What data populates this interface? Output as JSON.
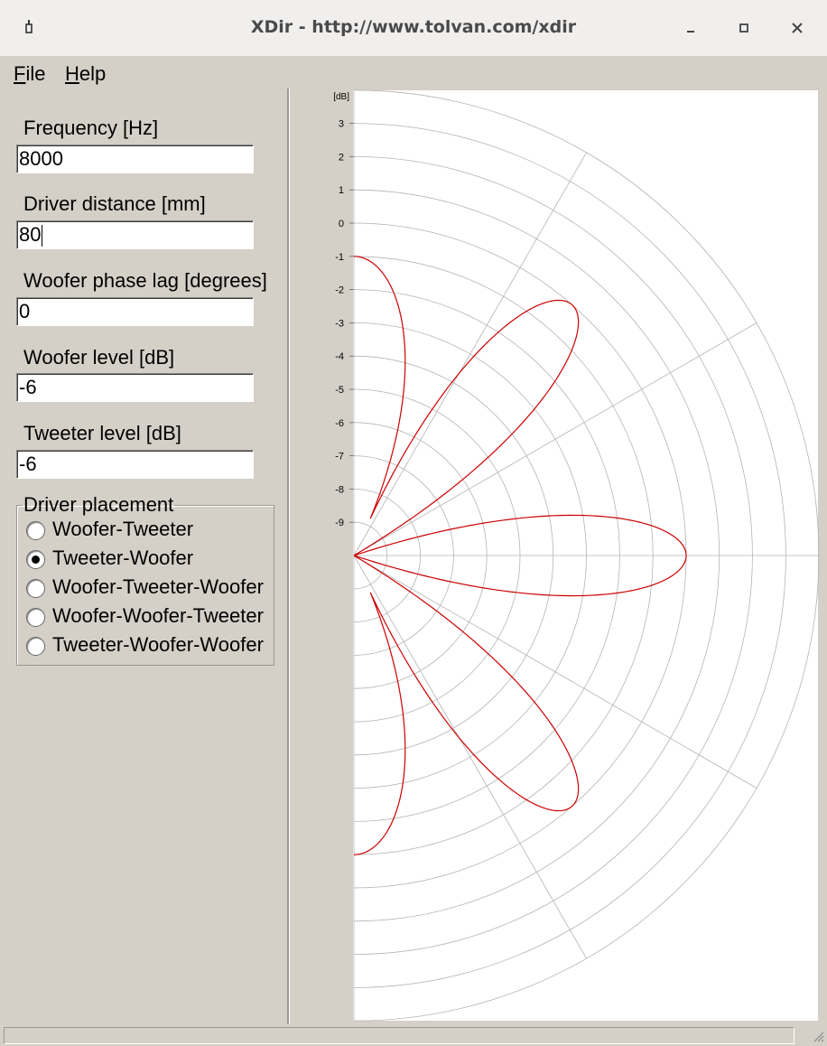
{
  "window": {
    "title": "XDir - http://www.tolvan.com/xdir",
    "icons": {
      "system": "pin-icon",
      "minimize": "minimize-icon",
      "maximize": "maximize-icon",
      "close": "close-icon"
    }
  },
  "menu": {
    "file": {
      "accel": "F",
      "rest": "ile"
    },
    "help": {
      "accel": "H",
      "rest": "elp"
    }
  },
  "form": {
    "frequency": {
      "label": "Frequency [Hz]",
      "value": "8000"
    },
    "driver_distance": {
      "label": "Driver distance [mm]",
      "value": "80"
    },
    "woofer_phase_lag": {
      "label": "Woofer phase lag [degrees]",
      "value": "0"
    },
    "woofer_level": {
      "label": "Woofer level [dB]",
      "value": "-6"
    },
    "tweeter_level": {
      "label": "Tweeter level [dB]",
      "value": "-6"
    }
  },
  "placement": {
    "legend": "Driver placement",
    "options": [
      {
        "label": "Woofer-Tweeter",
        "selected": false
      },
      {
        "label": "Tweeter-Woofer",
        "selected": true
      },
      {
        "label": "Woofer-Tweeter-Woofer",
        "selected": false
      },
      {
        "label": "Woofer-Woofer-Tweeter",
        "selected": false
      },
      {
        "label": "Tweeter-Woofer-Woofer",
        "selected": false
      }
    ]
  },
  "chart_data": {
    "type": "polar",
    "unit_label": "[dB]",
    "radial_range_db": [
      -10,
      4
    ],
    "radial_ticks": [
      "3",
      "2",
      "1",
      "0",
      "-1",
      "-2",
      "-3",
      "-4",
      "-5",
      "-6",
      "-7",
      "-8",
      "-9"
    ],
    "angle_range_deg": [
      -90,
      90
    ],
    "angle_grid_step_deg": 30,
    "grid": true,
    "series": [
      {
        "color": "#cc0000",
        "lobes": [
          {
            "center_deg": 0,
            "peak_db": 0,
            "half_width_deg": 10
          },
          {
            "center_deg": 49,
            "peak_db": 0,
            "half_width_deg": 10
          },
          {
            "center_deg": -49,
            "peak_db": 0,
            "half_width_deg": 10
          },
          {
            "center_deg": 90,
            "peak_db": -1,
            "half_width_deg": 15
          },
          {
            "center_deg": -90,
            "peak_db": -1,
            "half_width_deg": 15
          }
        ]
      }
    ]
  }
}
